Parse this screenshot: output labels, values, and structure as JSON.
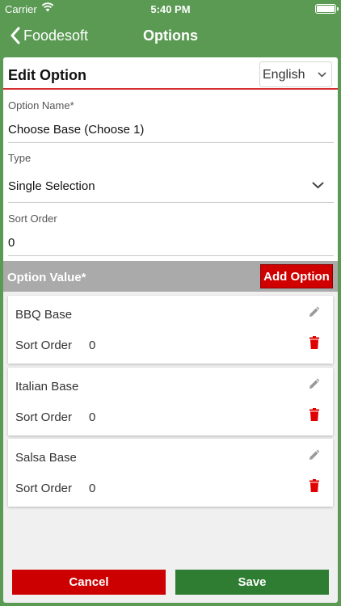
{
  "status_bar": {
    "carrier": "Carrier",
    "time": "5:40 PM"
  },
  "nav": {
    "back_label": "Foodesoft",
    "title": "Options"
  },
  "edit": {
    "title": "Edit Option",
    "language": "English",
    "option_name_label": "Option Name*",
    "option_name_value": "Choose Base (Choose 1)",
    "type_label": "Type",
    "type_value": "Single Selection",
    "sort_order_label": "Sort Order",
    "sort_order_value": "0"
  },
  "option_values": {
    "header": "Option Value*",
    "add_label": "Add Option",
    "items": [
      {
        "name": "BBQ Base",
        "sort_label": "Sort Order",
        "sort_value": "0"
      },
      {
        "name": "Italian Base",
        "sort_label": "Sort Order",
        "sort_value": "0"
      },
      {
        "name": "Salsa Base",
        "sort_label": "Sort Order",
        "sort_value": "0"
      }
    ]
  },
  "actions": {
    "cancel": "Cancel",
    "save": "Save"
  },
  "colors": {
    "nav_green": "#5a9a53",
    "accent_red": "#d00000",
    "save_green": "#2e7d32",
    "header_gray": "#aaaaaa"
  },
  "icons": [
    "wifi-icon",
    "battery-icon",
    "chevron-left-icon",
    "chevron-down-icon",
    "pencil-icon",
    "trash-icon"
  ]
}
